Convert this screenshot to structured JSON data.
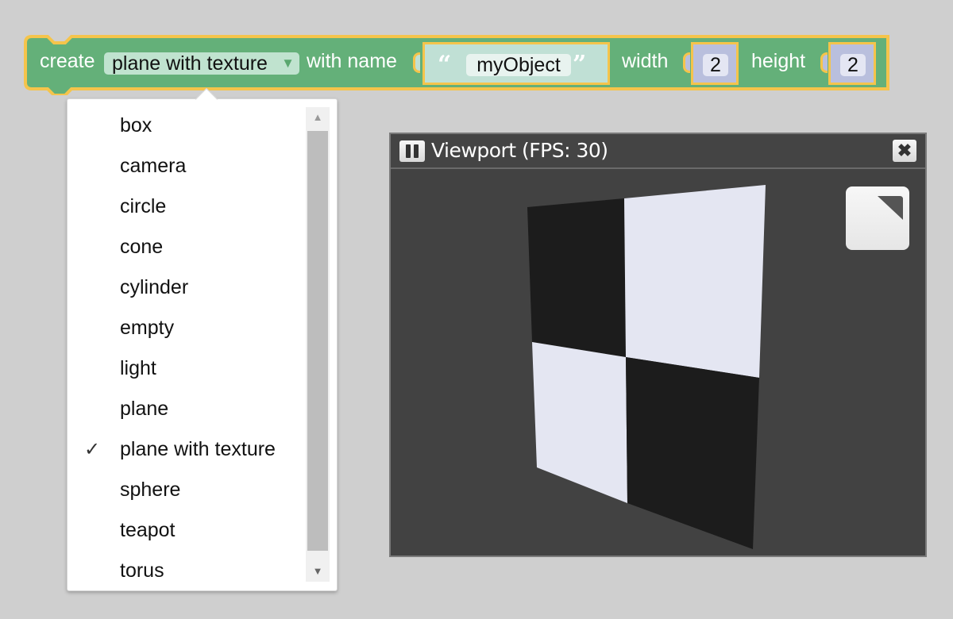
{
  "workspace": {
    "block": {
      "label_create": "create",
      "object_type_selected": "plane with texture",
      "label_with_name": "with name",
      "name_open_quote": "“",
      "name_value": "myObject",
      "name_close_quote": "”",
      "label_width": "width",
      "width_value": "2",
      "label_height": "height",
      "height_value": "2",
      "colors": {
        "block_fill": "#64b079",
        "highlight": "#f5c44b",
        "dropdown_field": "#c0e3cf",
        "string_block": "#c0e0d5",
        "number_block": "#b9bfdd"
      }
    },
    "dropdown_menu": {
      "items": [
        {
          "label": "box",
          "checked": false
        },
        {
          "label": "camera",
          "checked": false
        },
        {
          "label": "circle",
          "checked": false
        },
        {
          "label": "cone",
          "checked": false
        },
        {
          "label": "cylinder",
          "checked": false
        },
        {
          "label": "empty",
          "checked": false
        },
        {
          "label": "light",
          "checked": false
        },
        {
          "label": "plane",
          "checked": false
        },
        {
          "label": "plane with texture",
          "checked": true
        },
        {
          "label": "sphere",
          "checked": false
        },
        {
          "label": "teapot",
          "checked": false
        },
        {
          "label": "torus",
          "checked": false
        }
      ],
      "check_glyph": "✓",
      "scroll_up_glyph": "▲",
      "scroll_down_glyph": "▼"
    }
  },
  "viewport": {
    "title": "Viewport (FPS: 30)",
    "close_glyph": "✖",
    "colors": {
      "background": "#424242",
      "dark_tile": "#1c1c1c",
      "light_tile": "#e4e6f2"
    }
  }
}
